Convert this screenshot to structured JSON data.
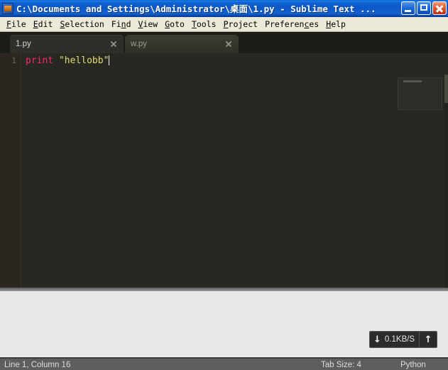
{
  "window": {
    "title": "C:\\Documents and Settings\\Administrator\\桌面\\1.py - Sublime Text ...",
    "icon": "sublime-app-icon",
    "controls": {
      "minimize_label": "Minimize",
      "maximize_label": "Maximize",
      "close_label": "Close"
    },
    "titlebar_color": "#0C58C8",
    "titlebar_text_color": "#FFFFFF"
  },
  "menubar": {
    "items": [
      {
        "label": "File",
        "accel": "F"
      },
      {
        "label": "Edit",
        "accel": "E"
      },
      {
        "label": "Selection",
        "accel": "S"
      },
      {
        "label": "Find",
        "accel": "n"
      },
      {
        "label": "View",
        "accel": "V"
      },
      {
        "label": "Goto",
        "accel": "G"
      },
      {
        "label": "Tools",
        "accel": "T"
      },
      {
        "label": "Project",
        "accel": "P"
      },
      {
        "label": "Preferences",
        "accel": "c"
      },
      {
        "label": "Help",
        "accel": "H"
      }
    ]
  },
  "tabs": [
    {
      "label": "1.py",
      "active": true,
      "close_icon": "close-icon"
    },
    {
      "label": "w.py",
      "active": false,
      "close_icon": "close-icon"
    }
  ],
  "editor": {
    "background_color": "#272822",
    "line_number": "1",
    "code": {
      "keyword": "print",
      "space": " ",
      "string": "\"hellobb\""
    }
  },
  "speed_widget": {
    "download_icon": "arrow-down-icon",
    "download_value": "0.1KB/S",
    "upload_icon": "arrow-up-icon"
  },
  "statusbar": {
    "cursor_position": "Line 1, Column 16",
    "tab_size": "Tab Size: 4",
    "syntax": "Python",
    "background_color": "#5E5E5E"
  }
}
